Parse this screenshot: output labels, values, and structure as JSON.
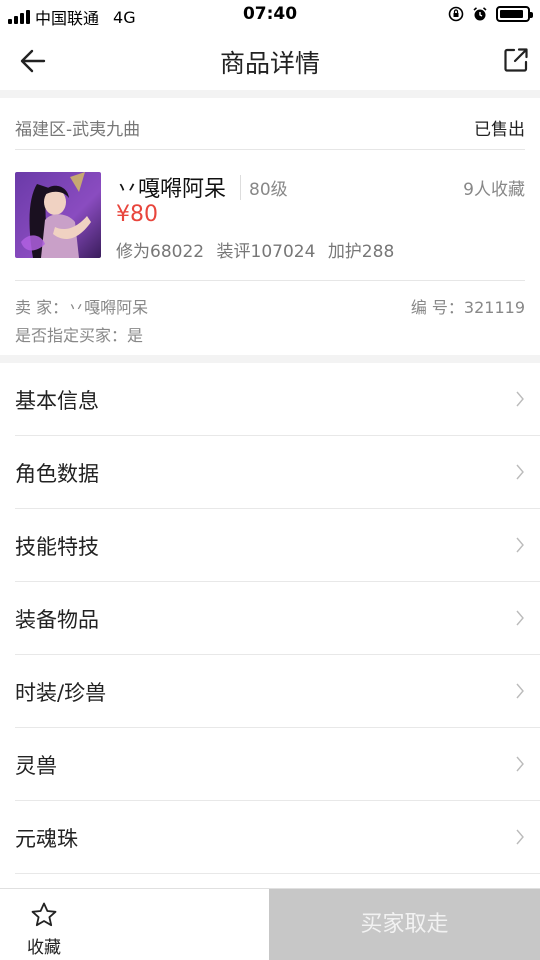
{
  "status_bar": {
    "carrier": "中国联通",
    "network": "4G",
    "time": "07:40",
    "battery_level": 0.9
  },
  "nav": {
    "title": "商品详情",
    "back_icon": "back-arrow-icon",
    "share_icon": "share-external-icon"
  },
  "listing": {
    "region": "福建区-武夷九曲",
    "status": "已售出",
    "character_name": "丷嘎嘚阿呆",
    "level": "80级",
    "favorites": "9人收藏",
    "price": "¥80",
    "stats": [
      "修为68022",
      "装评107024",
      "加护288"
    ],
    "seller": "卖 家：丷嘎嘚阿呆",
    "item_number": "编 号：321119",
    "designated_buyer": "是否指定买家：是"
  },
  "menu": {
    "items": [
      {
        "label": "基本信息"
      },
      {
        "label": "角色数据"
      },
      {
        "label": "技能特技"
      },
      {
        "label": "装备物品"
      },
      {
        "label": "时装/珍兽"
      },
      {
        "label": "灵兽"
      },
      {
        "label": "元魂珠"
      }
    ]
  },
  "bottom_bar": {
    "favorite_label": "收藏",
    "favorite_icon": "star-outline-icon",
    "buy_label": "买家取走"
  },
  "colors": {
    "price": "#e8453c",
    "disabled_button": "#c7c7c7",
    "divider": "#e8e8e8",
    "section_gap": "#f3f3f3"
  }
}
